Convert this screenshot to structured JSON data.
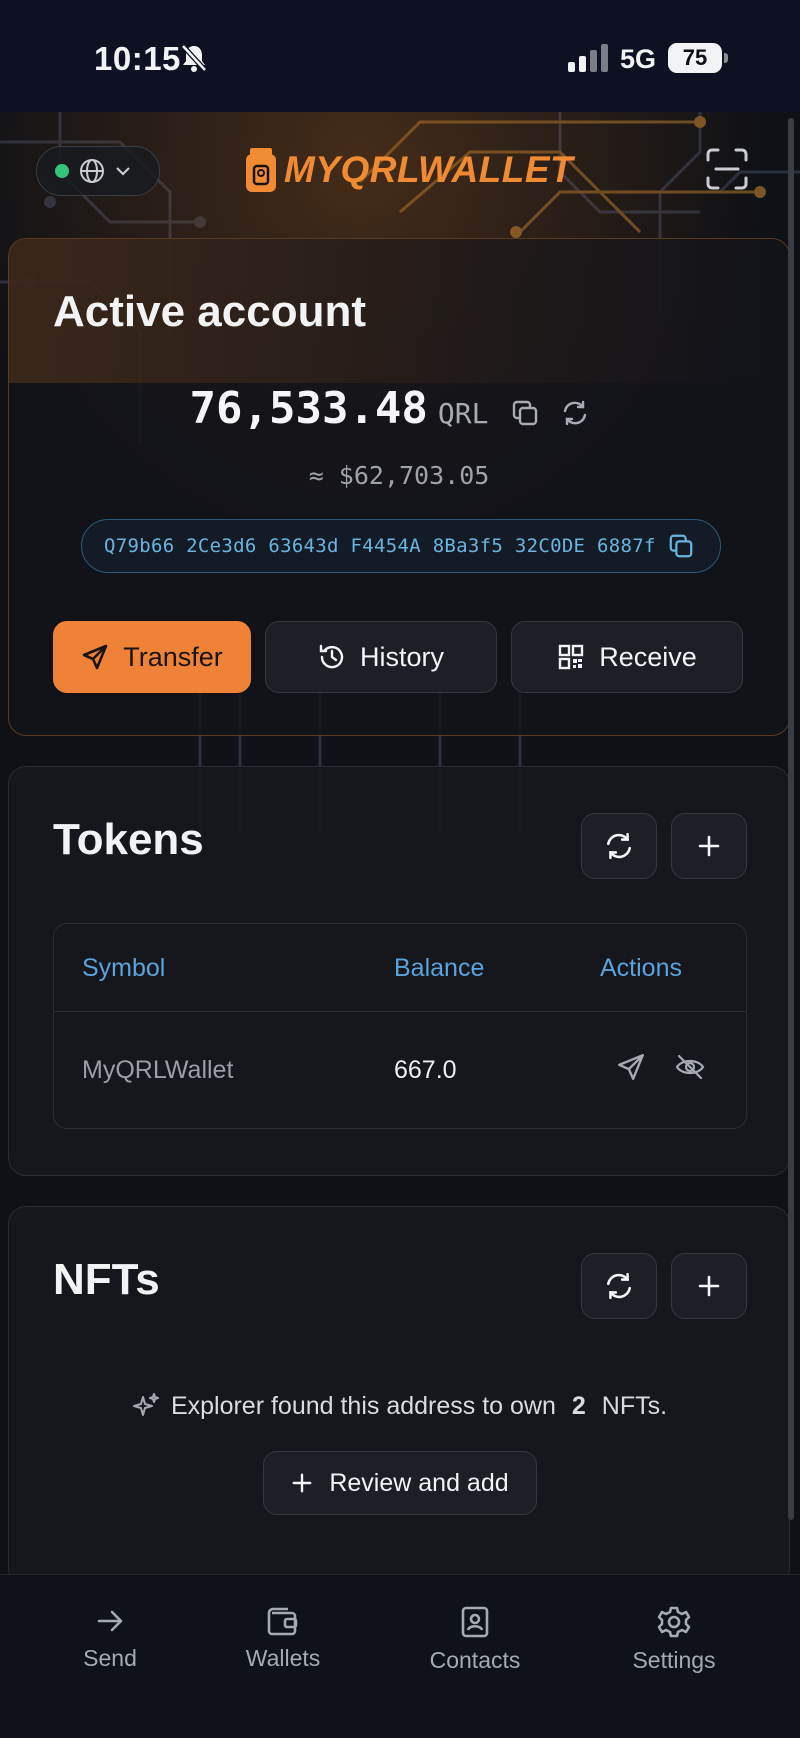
{
  "status_bar": {
    "time": "10:15",
    "network": "5G",
    "battery": "75"
  },
  "header": {
    "logo_text": "MYQRLWALLET"
  },
  "active_account": {
    "title": "Active account",
    "balance": "76,533.48",
    "unit": "QRL",
    "fiat": "≈ $62,703.05",
    "address": "Q79b66 2Ce3d6 63643d F4454A 8Ba3f5 32C0DE 6887f",
    "actions": {
      "transfer": "Transfer",
      "history": "History",
      "receive": "Receive"
    }
  },
  "tokens": {
    "title": "Tokens",
    "columns": [
      "Symbol",
      "Balance",
      "Actions"
    ],
    "rows": [
      {
        "symbol": "MyQRLWallet",
        "balance": "667.0"
      }
    ]
  },
  "nfts": {
    "title": "NFTs",
    "message_prefix": "Explorer found this address to own",
    "count": "2",
    "message_suffix": "NFTs.",
    "review_label": "Review and add"
  },
  "bottom_nav": {
    "send": "Send",
    "wallets": "Wallets",
    "contacts": "Contacts",
    "settings": "Settings"
  },
  "colors": {
    "accent": "#ee8236",
    "link": "#5aa3dc",
    "online": "#37c27a"
  }
}
